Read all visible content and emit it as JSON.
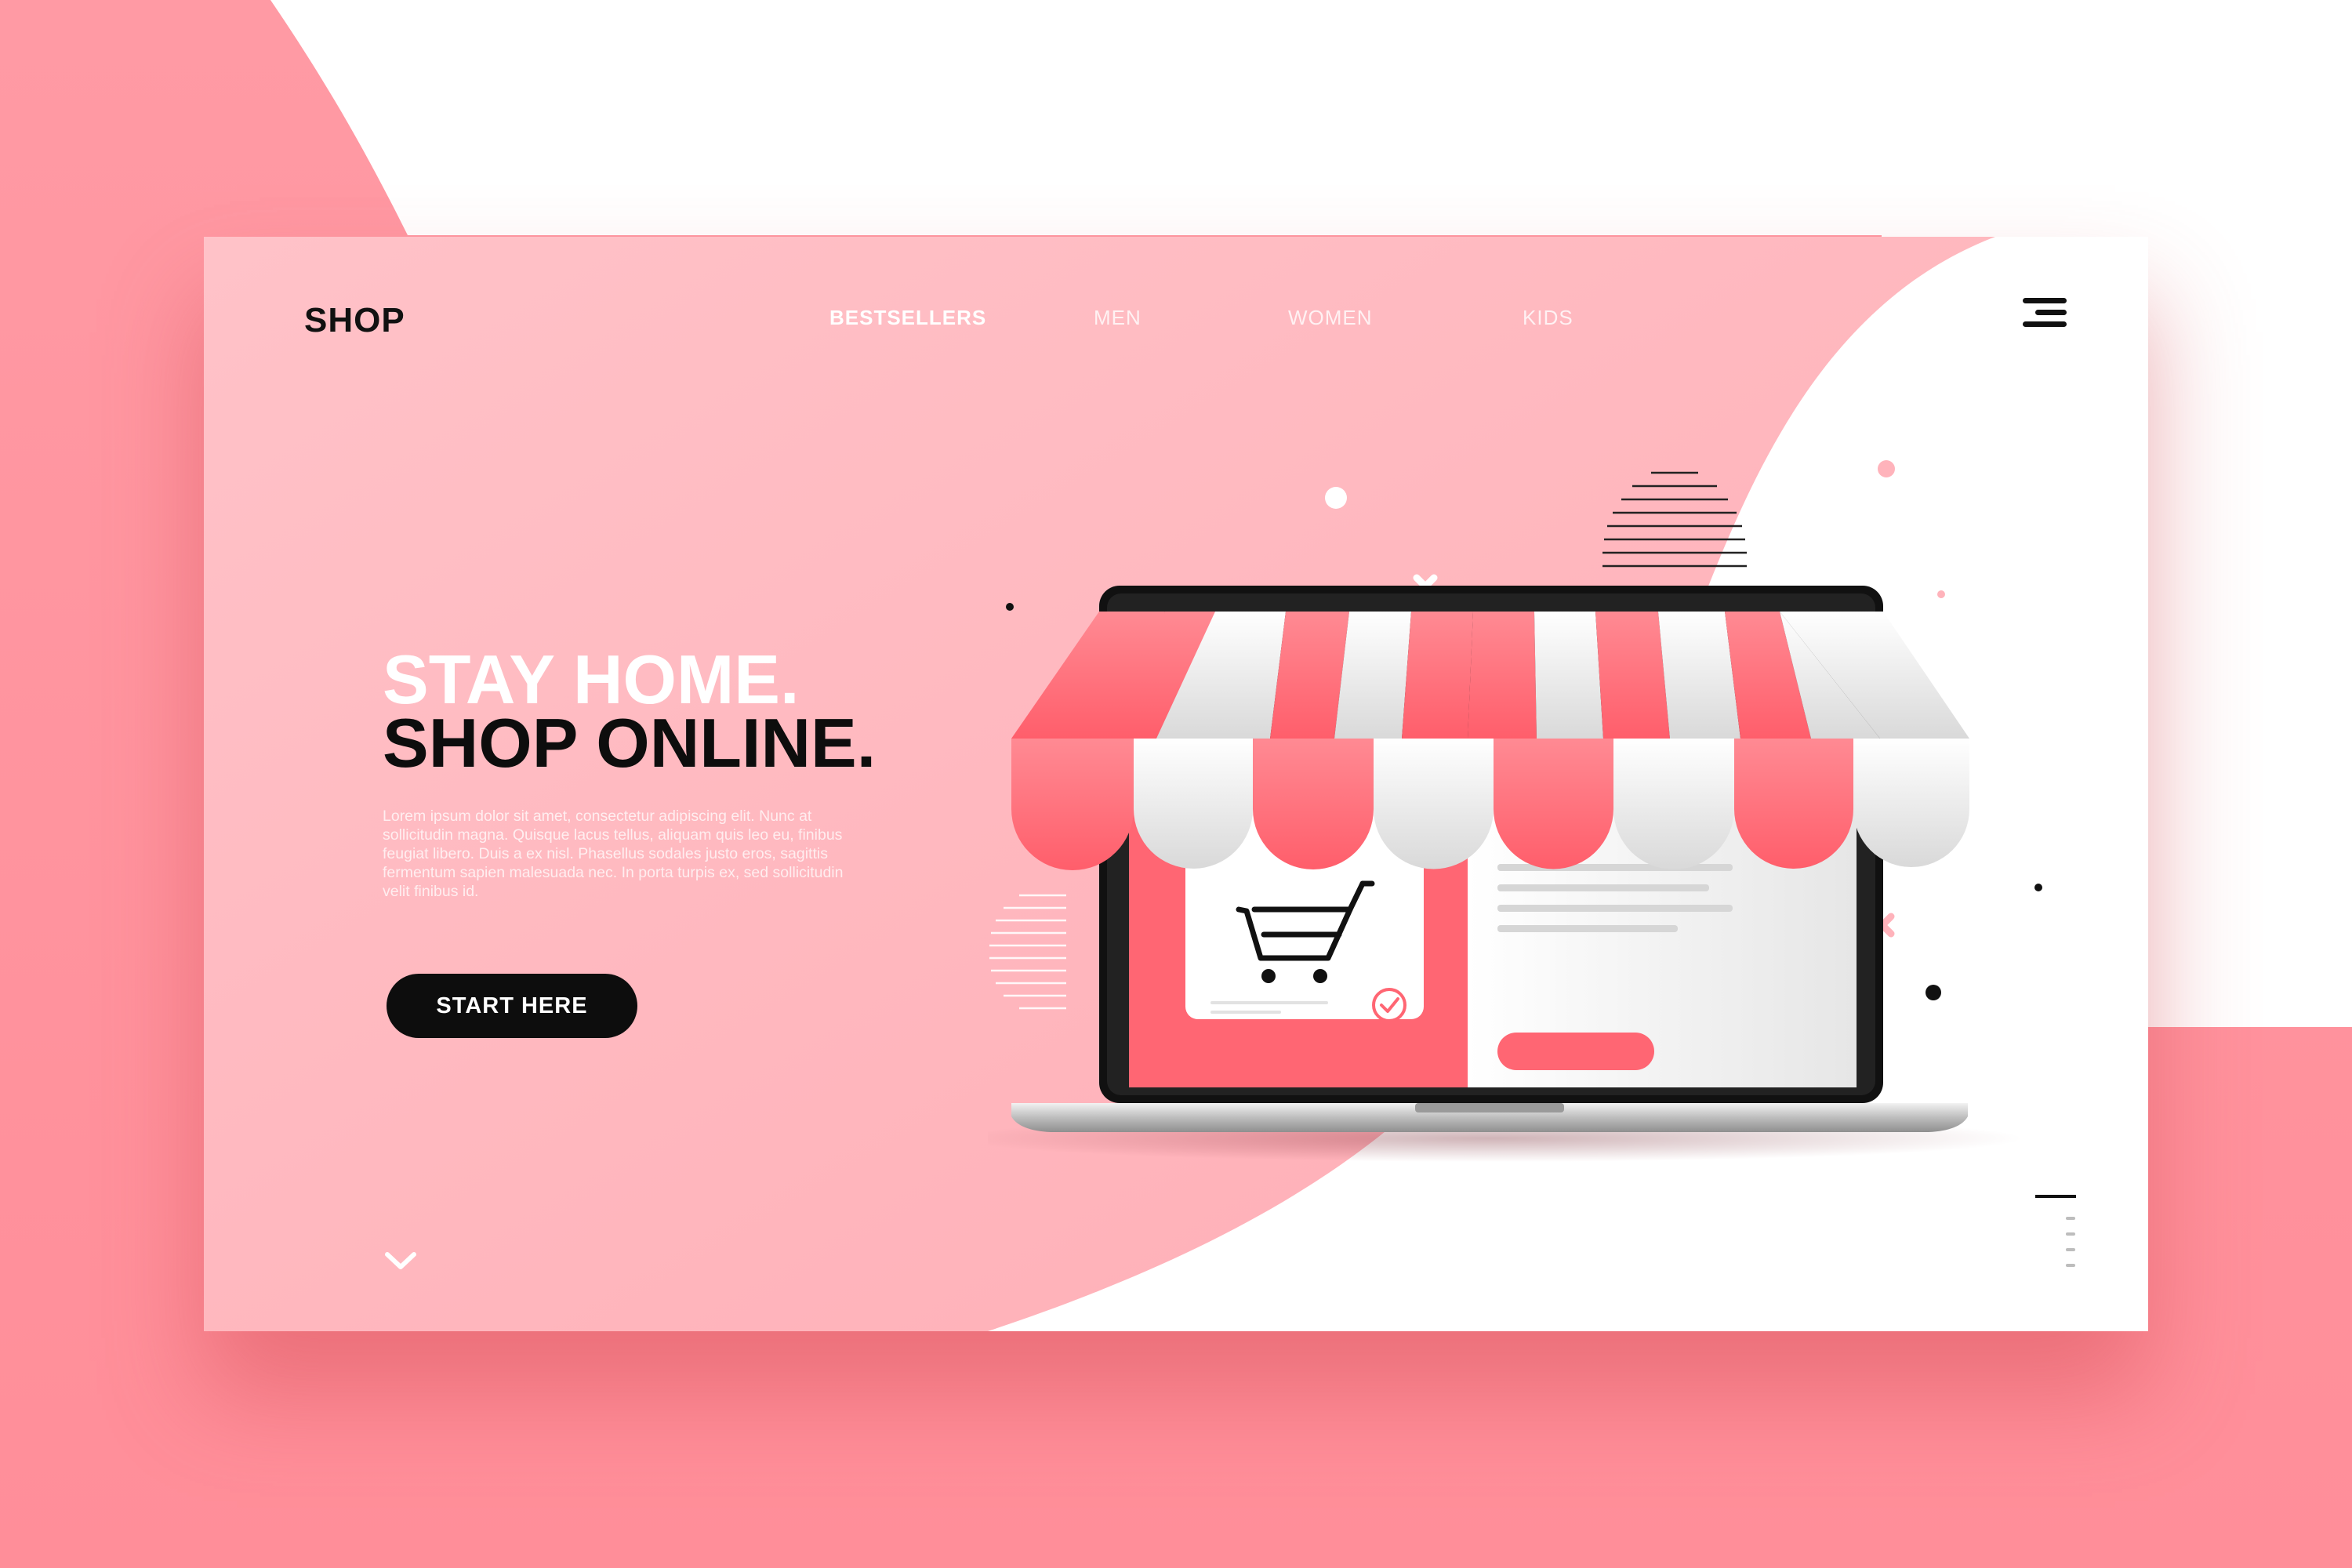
{
  "brand": {
    "logo": "SHOP"
  },
  "nav": {
    "items": [
      {
        "label": "BESTSELLERS",
        "active": true
      },
      {
        "label": "MEN",
        "active": false
      },
      {
        "label": "WOMEN",
        "active": false
      },
      {
        "label": "KIDS",
        "active": false
      }
    ]
  },
  "hero": {
    "line1": "STAY HOME.",
    "line2": "SHOP ONLINE.",
    "body": "Lorem ipsum dolor sit amet, consectetur adipiscing elit. Nunc at sollicitudin magna. Quisque lacus tellus, aliquam quis leo eu, finibus feugiat libero. Duis a ex nisl. Phasellus sodales justo eros, sagittis fermentum sapien malesuada nec. In porta turpis ex, sed sollicitudin velit finibus id.",
    "cta_label": "START HERE"
  },
  "icons": {
    "menu": "hamburger-menu-icon",
    "scroll": "chevron-down-icon",
    "cart": "shopping-cart-icon",
    "check": "check-circle-icon"
  },
  "colors": {
    "primary_pink": "#ffb3bb",
    "accent_red": "#ff6673",
    "dark": "#0d0d0d",
    "white": "#ffffff"
  },
  "pager": {
    "pages": 4,
    "active_page": 1
  }
}
